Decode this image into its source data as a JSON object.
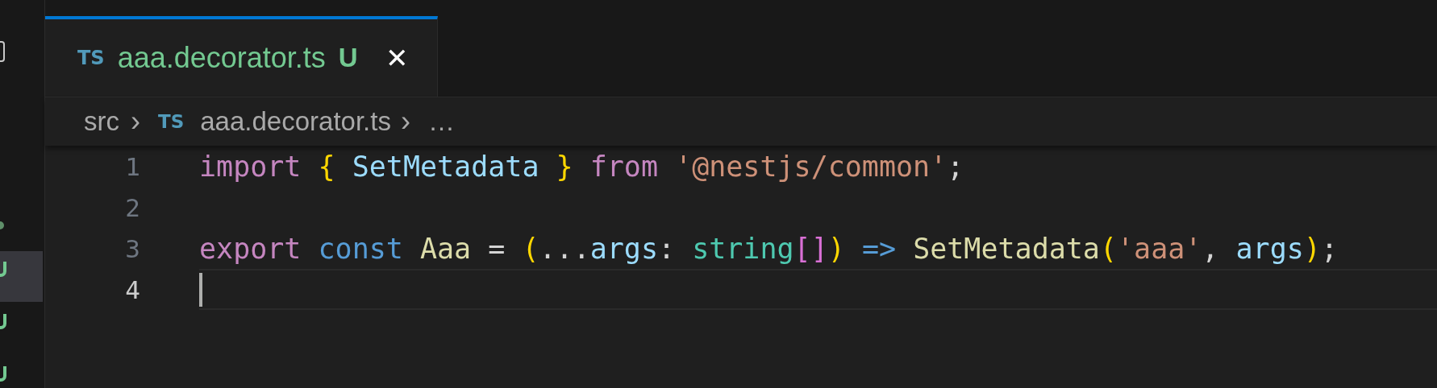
{
  "tabs": [
    {
      "icon": "TS",
      "label": "aaa.decorator.ts",
      "badge": "U",
      "close": "✕",
      "selected": true
    }
  ],
  "breadcrumb": [
    {
      "kind": "folder",
      "label": "src"
    },
    {
      "kind": "file",
      "icon": "TS",
      "label": "aaa.decorator.ts"
    },
    {
      "kind": "more",
      "label": "…"
    }
  ],
  "breadcrumb_separator": "›",
  "editor": {
    "lines": [
      {
        "number": "1",
        "current": false,
        "tokens": [
          {
            "kind": "keyword",
            "text": "import "
          },
          {
            "kind": "bracket",
            "text": "{ "
          },
          {
            "kind": "variable",
            "text": "SetMetadata "
          },
          {
            "kind": "bracket",
            "text": "} "
          },
          {
            "kind": "keyword",
            "text": "from "
          },
          {
            "kind": "string",
            "text": "'@nestjs/common'"
          },
          {
            "kind": "plain",
            "text": ";"
          }
        ]
      },
      {
        "number": "2",
        "current": false
      },
      {
        "number": "3",
        "current": false,
        "tokens": [
          {
            "kind": "keyword",
            "text": "export "
          },
          {
            "kind": "storage",
            "text": "const "
          },
          {
            "kind": "function",
            "text": "Aaa "
          },
          {
            "kind": "plain",
            "text": "= "
          },
          {
            "kind": "bracket",
            "text": "("
          },
          {
            "kind": "plain",
            "text": "..."
          },
          {
            "kind": "variable",
            "text": "args"
          },
          {
            "kind": "plain",
            "text": ": "
          },
          {
            "kind": "type",
            "text": "string"
          },
          {
            "kind": "bracket2",
            "text": "[]"
          },
          {
            "kind": "bracket",
            "text": ") "
          },
          {
            "kind": "storage",
            "text": "=> "
          },
          {
            "kind": "function",
            "text": "SetMetadata"
          },
          {
            "kind": "bracket",
            "text": "("
          },
          {
            "kind": "string",
            "text": "'aaa'"
          },
          {
            "kind": "plain",
            "text": ", "
          },
          {
            "kind": "variable",
            "text": "args"
          },
          {
            "kind": "bracket",
            "text": ")"
          },
          {
            "kind": "plain",
            "text": ";"
          }
        ]
      },
      {
        "number": "4",
        "current": true
      }
    ]
  }
}
